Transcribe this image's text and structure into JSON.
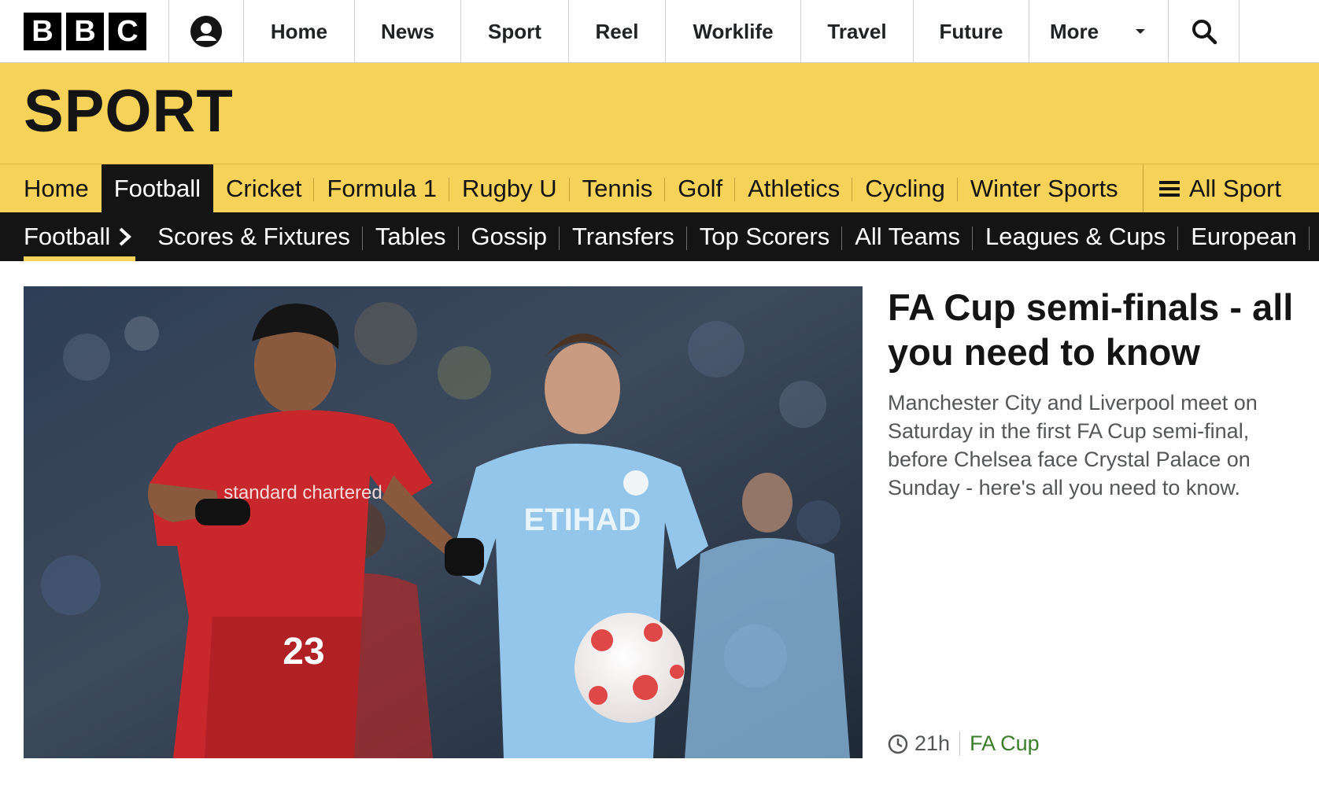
{
  "global_nav": {
    "logo_letters": [
      "B",
      "B",
      "C"
    ],
    "account_icon": "user-icon",
    "items": [
      {
        "label": "Home"
      },
      {
        "label": "News"
      },
      {
        "label": "Sport"
      },
      {
        "label": "Reel"
      },
      {
        "label": "Worklife"
      },
      {
        "label": "Travel"
      },
      {
        "label": "Future"
      }
    ],
    "more_label": "More",
    "search_icon": "search-icon"
  },
  "banner": {
    "title": "SPORT",
    "color": "#f7d258"
  },
  "section_nav": {
    "items": [
      {
        "label": "Home"
      },
      {
        "label": "Football"
      },
      {
        "label": "Cricket"
      },
      {
        "label": "Formula 1"
      },
      {
        "label": "Rugby U"
      },
      {
        "label": "Tennis"
      },
      {
        "label": "Golf"
      },
      {
        "label": "Athletics"
      },
      {
        "label": "Cycling"
      },
      {
        "label": "Winter Sports"
      }
    ],
    "active": "Football",
    "all_sport_label": "All Sport"
  },
  "sub_nav": {
    "current": "Football",
    "items": [
      {
        "label": "Scores & Fixtures"
      },
      {
        "label": "Tables"
      },
      {
        "label": "Gossip"
      },
      {
        "label": "Transfers"
      },
      {
        "label": "Top Scorers"
      },
      {
        "label": "All Teams"
      },
      {
        "label": "Leagues & Cups"
      },
      {
        "label": "European"
      }
    ]
  },
  "hero": {
    "headline": "FA Cup semi-finals - all you need to know",
    "summary": "Manchester City and Liverpool meet on Saturday in the first FA Cup semi-final, before Chelsea face Crystal Palace on Sunday - here's all you need to know.",
    "time": "21h",
    "tag": "FA Cup",
    "image": {
      "sponsor_text_red": "standard chartered",
      "shirt_number": "23",
      "sponsor_text_blue": "ETIHAD"
    }
  }
}
